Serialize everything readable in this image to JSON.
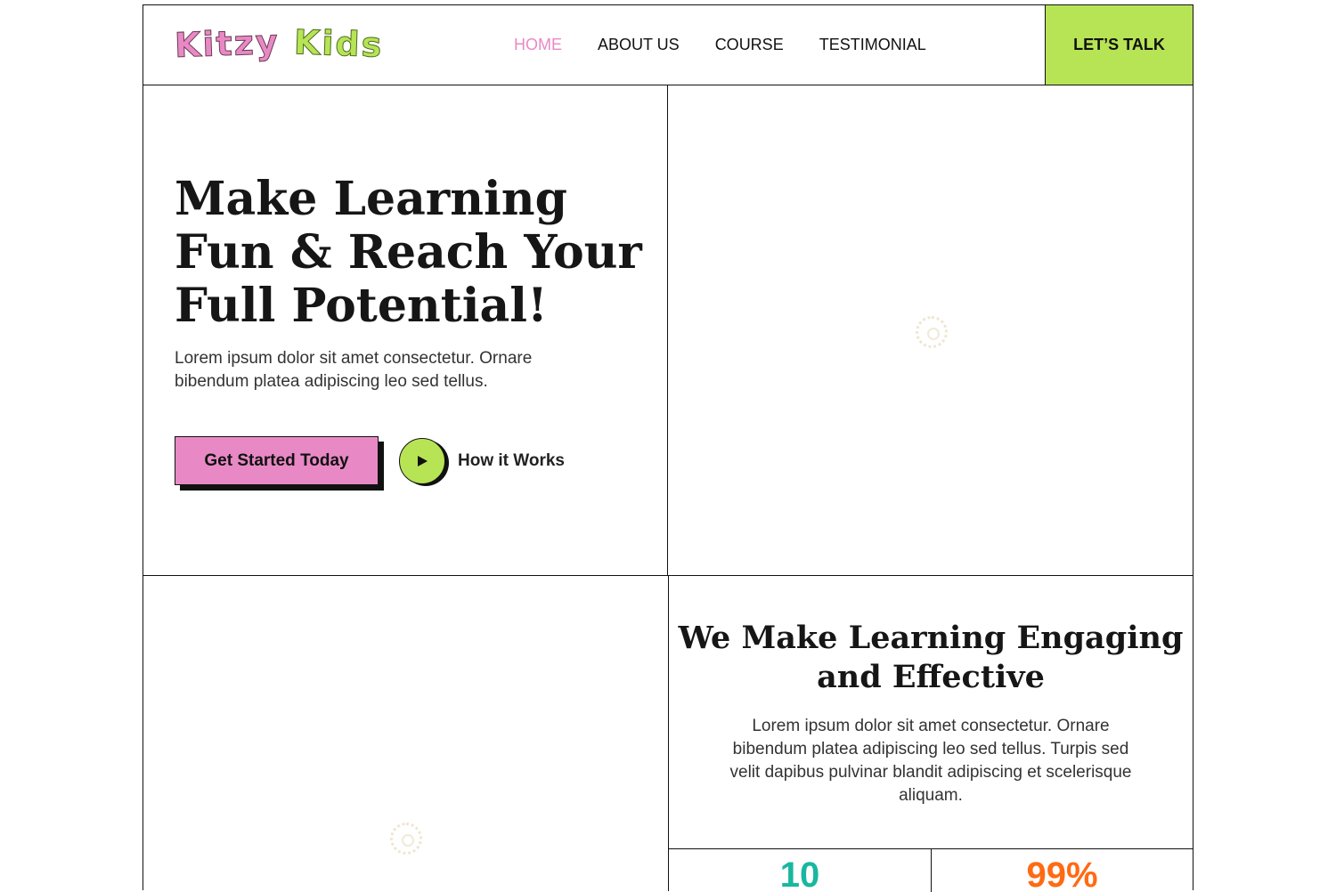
{
  "brand": {
    "word1": "Kitzy",
    "word2": "Kids"
  },
  "nav": {
    "items": [
      {
        "label": "HOME",
        "active": true
      },
      {
        "label": "ABOUT US",
        "active": false
      },
      {
        "label": "COURSE",
        "active": false
      },
      {
        "label": "TESTIMONIAL",
        "active": false
      }
    ],
    "cta_label": "LET’S TALK"
  },
  "hero": {
    "title": "Make Learning Fun & Reach Your Full Potential!",
    "description": "Lorem ipsum dolor sit amet consectetur. Ornare bibendum platea adipiscing leo sed tellus.",
    "primary_button": "Get Started Today",
    "secondary_button": "How it Works"
  },
  "section": {
    "title": "We Make Learning Engaging and Effective",
    "description": "Lorem ipsum dolor sit amet consectetur. Ornare bibendum platea adipiscing leo sed tellus. Turpis sed velit dapibus pulvinar blandit adipiscing et scelerisque aliquam."
  },
  "stats": [
    {
      "value": "10"
    },
    {
      "value": "99%"
    }
  ],
  "colors": {
    "pink": "#e889c5",
    "lime": "#b7e455",
    "teal": "#18b7a0",
    "orange": "#ff6a14",
    "ink": "#111111"
  },
  "icons": {
    "play": "play-icon",
    "loading": "loading-spinner-icon"
  }
}
